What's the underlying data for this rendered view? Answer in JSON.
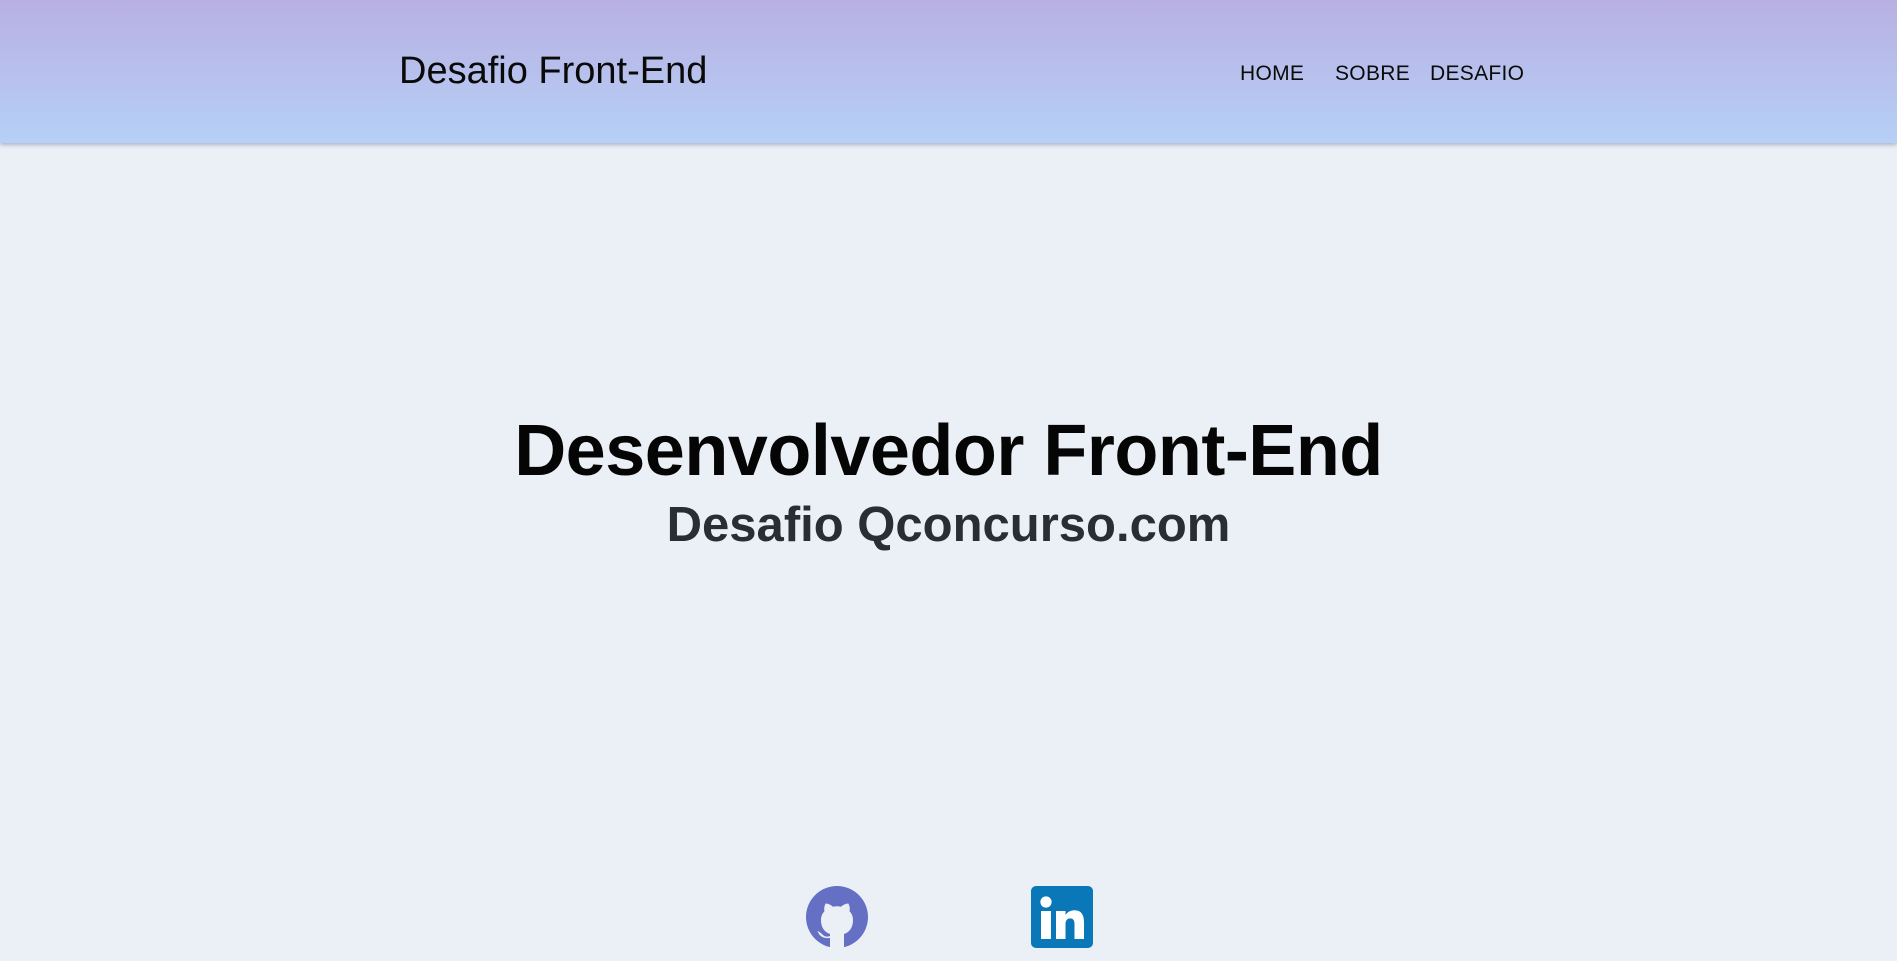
{
  "header": {
    "brand": "Desafio Front-End",
    "nav": [
      {
        "label": "HOME"
      },
      {
        "label": "SOBRE"
      },
      {
        "label": "DESAFIO"
      }
    ]
  },
  "hero": {
    "title": "Desenvolvedor Front-End",
    "subtitle": "Desafio Qconcurso.com"
  },
  "social": {
    "github": {
      "icon": "github-icon",
      "color": "#6570c4"
    },
    "linkedin": {
      "icon": "linkedin-icon",
      "color": "#0a78b8"
    }
  },
  "colors": {
    "background": "#ebf0f7",
    "header_gradient_top": "#b8b0e2",
    "header_gradient_bottom": "#b6d0f6"
  }
}
